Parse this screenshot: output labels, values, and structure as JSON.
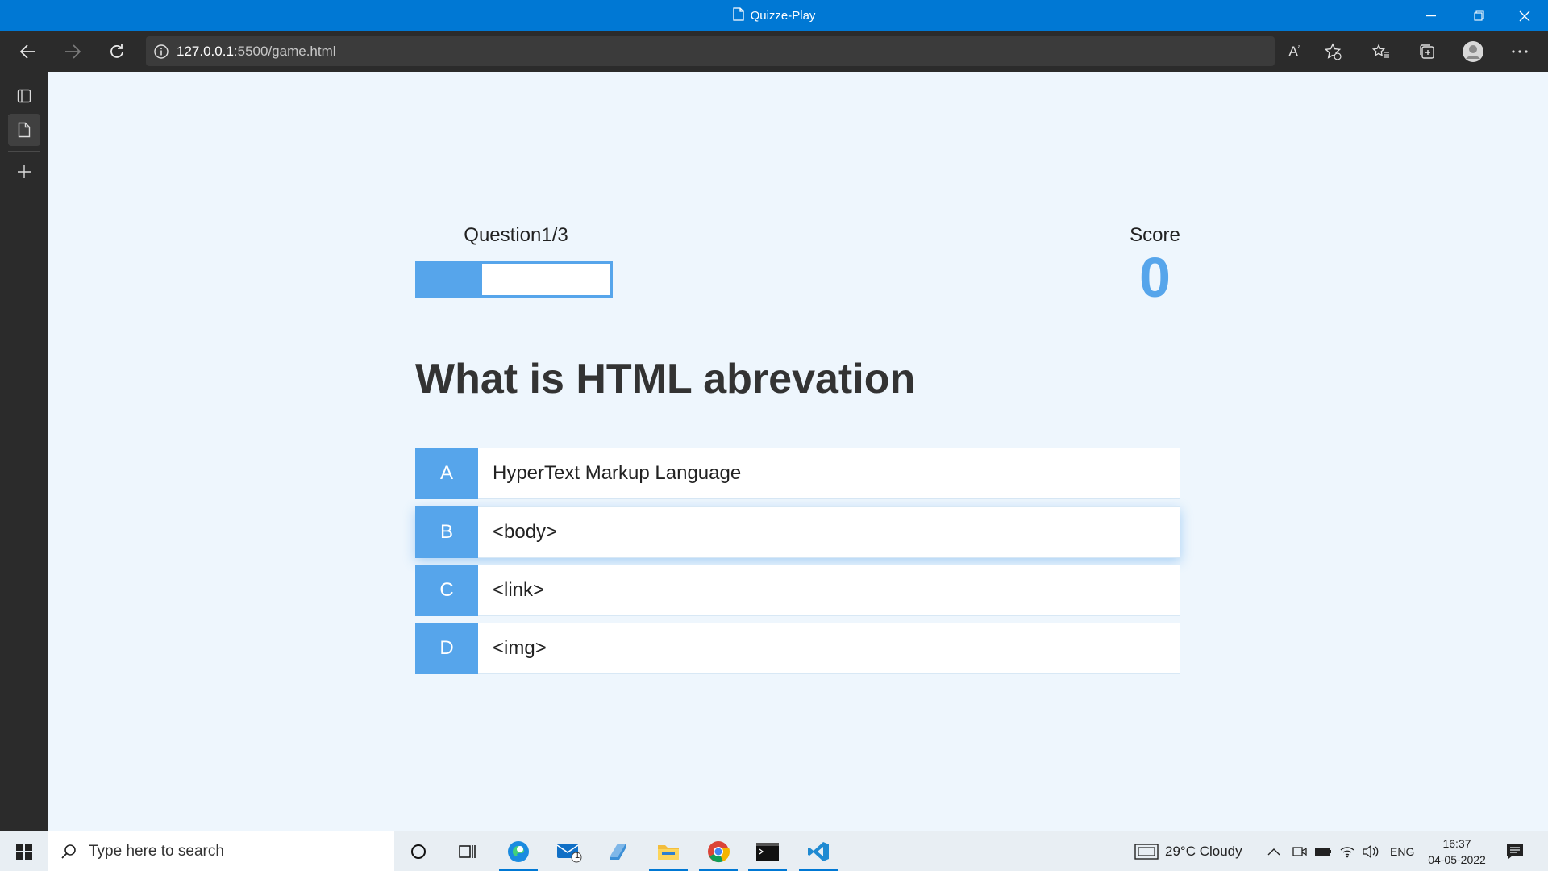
{
  "window": {
    "title": "Quizze-Play"
  },
  "browser": {
    "url_host": "127.0.0.1",
    "url_rest": ":5500/game.html"
  },
  "game": {
    "question_label": "Question1/3",
    "progress_fraction": 0.333,
    "score_label": "Score",
    "score_value": "0",
    "question": "What is HTML abrevation",
    "choices": [
      {
        "prefix": "A",
        "text": "HyperText Markup Language"
      },
      {
        "prefix": "B",
        "text": "<body>"
      },
      {
        "prefix": "C",
        "text": "<link>"
      },
      {
        "prefix": "D",
        "text": "<img>"
      }
    ]
  },
  "taskbar": {
    "search_placeholder": "Type here to search",
    "weather": "29°C  Cloudy",
    "language": "ENG",
    "time": "16:37",
    "date": "04-05-2022",
    "mail_badge": "1"
  },
  "colors": {
    "accent": "#56a5eb",
    "titlebar": "#0078d4"
  }
}
